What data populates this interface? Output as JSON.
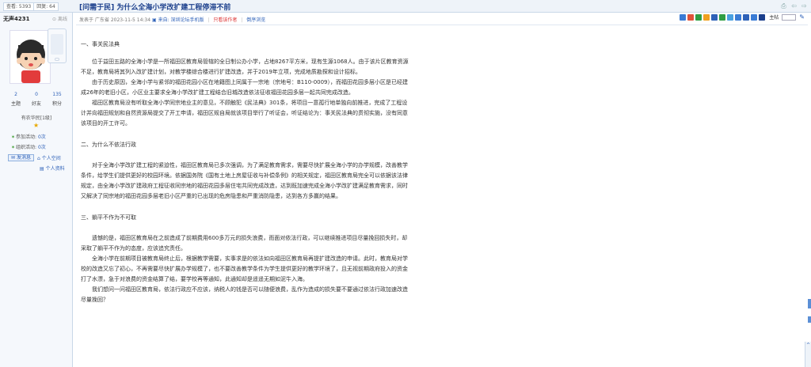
{
  "topbar": {
    "views": "查看: 5393",
    "replies": "回复: 64",
    "title_prefix": "[问需于民]",
    "title": "为什么全海小学改扩建工程停滞不前",
    "icons": [
      "print-icon",
      "prev-icon",
      "next-icon"
    ]
  },
  "user": {
    "name": "无声4231",
    "status": "离线",
    "counts": [
      {
        "value": "2",
        "label": "主题"
      },
      {
        "value": "0",
        "label": "好友"
      },
      {
        "value": "135",
        "label": "积分"
      }
    ],
    "level": "有农华民[1级]",
    "activity": [
      {
        "label": "参加活动:",
        "value": "0次"
      },
      {
        "label": "组织活动:",
        "value": "0次"
      }
    ],
    "send_msg": "发消息",
    "space": "个人空间",
    "profile": "个人资料"
  },
  "post": {
    "meta_published": "发表于 广东省 2023-11-5 14:34",
    "meta_source": "来自: 深圳论坛手机版",
    "meta_only_author": "只看该作者",
    "meta_desc": "倒序浏览",
    "tool_label": "主帖",
    "tool_colors": [
      "#3a7bd5",
      "#e0533b",
      "#2f9e44",
      "#f0a020",
      "#2e61b8",
      "#2f9e44",
      "#4aa0e0",
      "#3a7bd5",
      "#2e61b8",
      "#3a7bd5",
      "#1b3f8c"
    ]
  },
  "article": {
    "s1_title": "一、事关民法典",
    "s1_p1": "位于益田五路的全海小学是一所福田区教育局管辖的全日制公办小学，占地8267平方米，现有生源1068人。由于该片区教育资源不足，教育局将其列入改扩建计划，对教学楼综合楼进行扩建改造，并于2019年立项，完成地质勘探和设计招标。",
    "s1_p2": "由于历史原因，全海小学与紧邻的福田花园小区在地籍图上同属于一宗地（宗地号：B110-0009），而福田花园多层小区是已经建成26年的老旧小区，小区业主要求全海小学改扩建工程结合旧城改造依法征收福田花园多层一起共同完成改造。",
    "s1_p3": "福田区教育局没有听取全海小学同宗地业主的意见，不顾触犯《民法典》301条，将项目一意孤行地单独向前推进，完成了工程设计并向福田规划和自然资源局提交了开工申请，福田区规自局就该项目举行了听证会，听证结论为：事关民法典的贯彻实施，没有同意该项目的开工许可。",
    "s2_title": "二、为什么不依法行政",
    "s2_p1": "对于全海小学改扩建工程的紧迫性，福田区教育局已多次强调，为了满足教育需求，需要尽快扩展全海小学的办学规模，改善教学条件，给学生们提供更好的校园环境。依据国务院《国有土地上房屋征收与补偿条例》的相关规定，福田区教育局完全可以依据该法律规定，由全海小学改扩建政府工程征收同宗地的福田花园多层住宅共同完成改造，达到既加速完成全海小学改扩建满足教育需求，同时又解决了同宗地的福田花园多层老旧小区严重的已出现的危房隐患和严重消防隐患，达到各方多赢的结果。",
    "s3_title": "三、躺平不作为不可取",
    "s3_p1": "遗憾的是，福田区教育局在之前造成了前期费用600多万元的损失浪费，而面对依法行政，可以继续推进项目尽量挽回损失时，却采取了躺平不作为的态度，应该追究责任。",
    "s3_p2": "全海小学在前期项目被教育局终止后，根据教学需要，实事求是的依法如向福田区教育局再提扩建改造的申请。此时，教育局对学校的改造又忘了初心，不再需要尽快扩展办学规模了，也不要改善教学条件为学生提供更好的教学环境了，且无视前期政府投入的资金打了水漂，急于对浪费的资金结算了结，要学校再等通知，此通知却是遥遥无期如泥牛入海。",
    "s3_p3": "我们想问一问福田区教育局，依法行政应不应该，纳税人的钱是否可以随便浪费，乱作为造成的损失要不要通过依法行政加速改造尽量挽回？"
  }
}
